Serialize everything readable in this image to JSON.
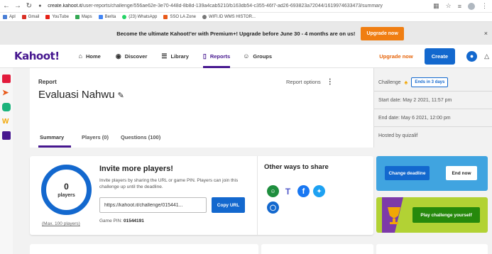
{
  "browser": {
    "url_host": "create.kahoot.it",
    "url_path": "/user-reports/challenge/556ae62e-3e70-448d-8b8d-139a4cab5210/b163db54-c355-46f7-ad26-693823a72044/1619974633473/summary",
    "bookmarks": [
      "Apl",
      "Gmail",
      "YouTube",
      "Maps",
      "Berita",
      "(23) WhatsApp",
      "SSO LA Zone",
      "WIFI.ID WMS HISTOR..."
    ]
  },
  "promo": {
    "text": "Become the ultimate Kahoot!'er with Premium+! Upgrade before June 30 - 4 months are on us!",
    "button": "Upgrade now",
    "close": "×"
  },
  "nav": {
    "logo": "Kahoot!",
    "home": "Home",
    "discover": "Discover",
    "library": "Library",
    "reports": "Reports",
    "groups": "Groups",
    "upgrade": "Upgrade now",
    "create": "Create"
  },
  "report": {
    "breadcrumb": "Report",
    "title": "Evaluasi Nahwu",
    "options": "Report options",
    "tabs": {
      "summary": "Summary",
      "players": "Players (0)",
      "questions": "Questions (100)"
    }
  },
  "challenge": {
    "label": "Challenge",
    "badge": "Ends in 3 days",
    "start": "Start date: May 2 2021, 11:57 pm",
    "end": "End date: May 6 2021, 12:00 pm",
    "host": "Hosted by quizalif"
  },
  "invite": {
    "count": "0",
    "count_label": "players",
    "max": "(Max. 100 players)",
    "title": "Invite more players!",
    "description": "Invite players by sharing the URL or game PIN. Players can join this challenge up until the deadline.",
    "url": "https://kahoot.it/challenge/015441...",
    "copy": "Copy URL",
    "pin_label": "Game PIN:",
    "pin": "01544191"
  },
  "share": {
    "title": "Other ways to share"
  },
  "actions": {
    "change_deadline": "Change deadline",
    "end_now": "End now",
    "play": "Play challenge yourself"
  },
  "colors": {
    "brand": "#46178f",
    "primary_blue": "#1368ce",
    "upgrade_orange": "#f07e12",
    "deadline_card": "#40a4e0",
    "play_card": "#b2d234",
    "play_button": "#26890c"
  }
}
